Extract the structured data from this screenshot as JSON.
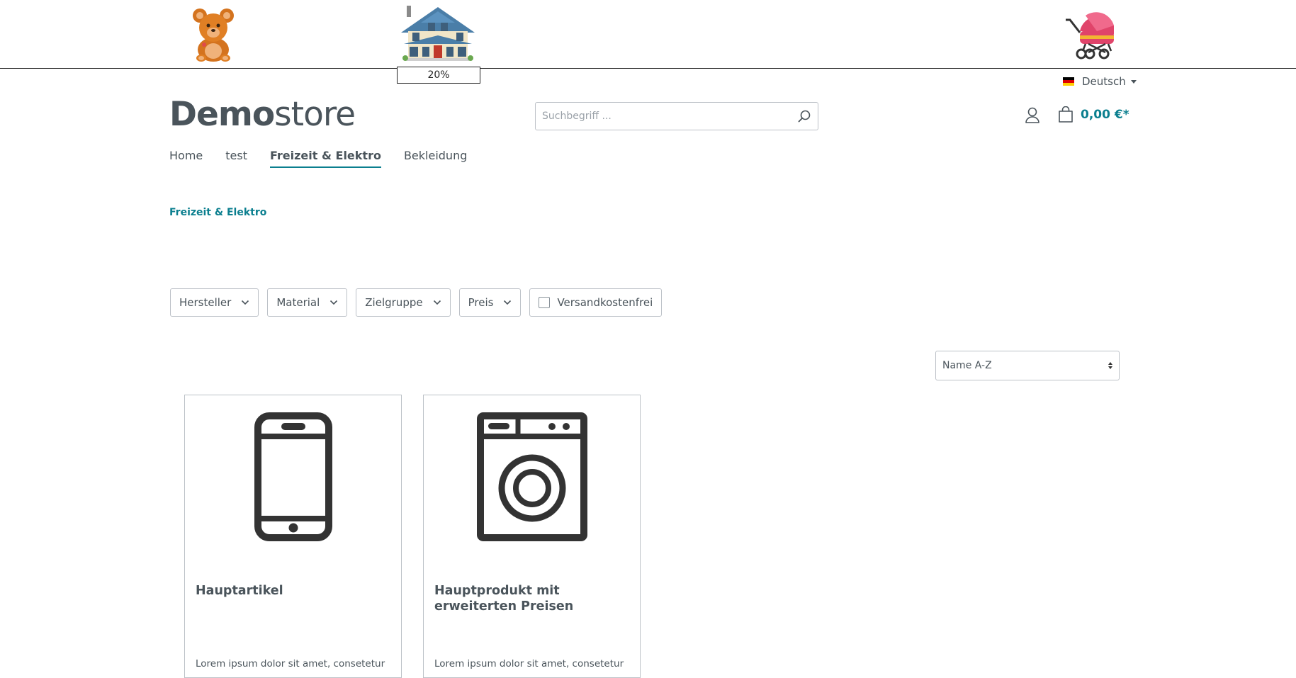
{
  "banner": {
    "progress_label": "20%",
    "progress_value": 0.2,
    "images": [
      "teddy-bear-icon",
      "house-icon",
      "stroller-icon"
    ]
  },
  "language": {
    "label": "Deutsch"
  },
  "logo": {
    "bold": "Demo",
    "light": "store"
  },
  "search": {
    "placeholder": "Suchbegriff ..."
  },
  "cart": {
    "total": "0,00 €*"
  },
  "nav": {
    "items": [
      {
        "label": "Home"
      },
      {
        "label": "test"
      },
      {
        "label": "Freizeit & Elektro",
        "active": true
      },
      {
        "label": "Bekleidung"
      }
    ]
  },
  "breadcrumb": {
    "label": "Freizeit & Elektro"
  },
  "filters": {
    "manufacturer": "Hersteller",
    "material": "Material",
    "target_group": "Zielgruppe",
    "price": "Preis",
    "free_shipping": "Versandkostenfrei"
  },
  "sort": {
    "selected": "Name A-Z"
  },
  "products": [
    {
      "title": "Hauptartikel",
      "description": "Lorem ipsum dolor sit amet, consetetur",
      "icon": "smartphone-icon"
    },
    {
      "title": "Hauptprodukt mit erweiterten Preisen",
      "description": "Lorem ipsum dolor sit amet, consetetur",
      "icon": "washing-machine-icon"
    }
  ],
  "colors": {
    "accent": "#0b7f8f",
    "text": "#4a545b"
  }
}
